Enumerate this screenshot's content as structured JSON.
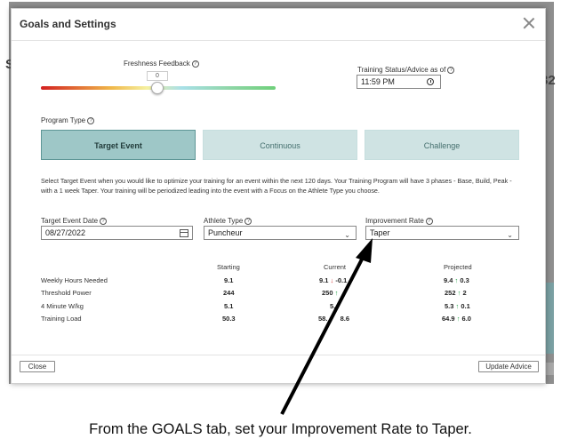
{
  "backdrop": {
    "fragment_left": "S",
    "fragment_right": "32"
  },
  "modal": {
    "title": "Goals and Settings",
    "close_icon": "close-icon"
  },
  "freshness": {
    "label": "Freshness Feedback",
    "value": "0",
    "slider_level": 0.5
  },
  "training_status": {
    "label": "Training Status/Advice as of",
    "time_value": "11:59  PM"
  },
  "program_type": {
    "label": "Program Type",
    "options": [
      "Target Event",
      "Continuous",
      "Challenge"
    ],
    "selected": "Target Event"
  },
  "description": "Select Target Event when you would like to optimize your training for an event within the next 120 days. Your Training Program will have 3 phases - Base, Build, Peak - with a 1 week Taper. Your training will be periodized leading into the event with a Focus on the Athlete Type you choose.",
  "fields": {
    "event_date_label": "Target Event Date",
    "event_date_value": "08/27/2022",
    "athlete_type_label": "Athlete Type",
    "athlete_type_value": "Puncheur",
    "improvement_rate_label": "Improvement Rate",
    "improvement_rate_value": "Taper"
  },
  "table": {
    "headers": [
      "Starting",
      "Current",
      "Projected"
    ],
    "rows": [
      {
        "label": "Weekly Hours Needed",
        "starting": "9.1",
        "current": "9.1",
        "current_delta": "-0.1",
        "current_dir": "down",
        "projected": "9.4",
        "projected_delta": "0.3"
      },
      {
        "label": "Threshold Power",
        "starting": "244",
        "current": "250",
        "current_delta": "",
        "current_dir": "up",
        "projected": "252",
        "projected_delta": "2"
      },
      {
        "label": "4 Minute W/kg",
        "starting": "5.1",
        "current": "5.",
        "current_delta": "",
        "current_dir": "",
        "projected": "5.3",
        "projected_delta": "0.1"
      },
      {
        "label": "Training Load",
        "starting": "50.3",
        "current": "58.",
        "current_delta": "8.6",
        "current_dir": "",
        "projected": "64.9",
        "projected_delta": "6.0"
      }
    ]
  },
  "footer": {
    "close_label": "Close",
    "update_label": "Update Advice"
  },
  "caption": "From the GOALS tab, set your Improvement Rate to Taper.",
  "colors": {
    "accent": "#9ec7c7",
    "accent_border": "#5e9696",
    "up_arrow": "#2fa84f",
    "down_arrow": "#d23c3c"
  }
}
